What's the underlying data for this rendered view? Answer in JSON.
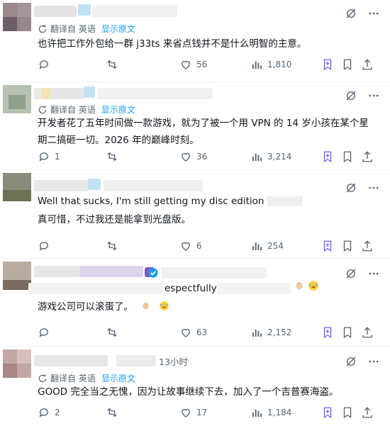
{
  "posts": [
    {
      "translate": {
        "label": "翻译自 英语",
        "show_original": "显示原文"
      },
      "text": "也许把工作外包给一群 j33ts 来省点钱并不是什么明智的主意。",
      "stats": {
        "replies": "",
        "reposts": "",
        "likes": "56",
        "views": "1,810"
      }
    },
    {
      "translate": {
        "label": "翻译自 英语",
        "show_original": "显示原文"
      },
      "text_line1": "开发者花了五年时间做一款游戏，就为了被一个用 VPN 的 14 岁小孩在某个星",
      "text_line2": "期二搞砸一切。2026 年的巅峰时刻。",
      "stats": {
        "replies": "1",
        "reposts": "",
        "likes": "36",
        "views": "3,214"
      }
    },
    {
      "original_text": "Well that sucks, I'm still getting my disc edition",
      "text": "真可惜，不过我还是能拿到光盘版。",
      "stats": {
        "replies": "",
        "reposts": "",
        "likes": "6",
        "views": "254"
      }
    },
    {
      "original_text_fragment": "espectfully",
      "text": "游戏公司可以滚蛋了。",
      "stats": {
        "replies": "",
        "reposts": "",
        "likes": "63",
        "views": "2,152"
      }
    },
    {
      "timestamp": "13小时",
      "translate": {
        "label": "翻译自 英语",
        "show_original": "显示原文"
      },
      "text": "GOOD 完全当之无愧，因为让故事继续下去，加入了一个吉普赛海盗。",
      "stats": {
        "replies": "2",
        "reposts": "",
        "likes": "17",
        "views": "1,184"
      }
    }
  ],
  "icons": [
    "translate-icon",
    "reply-icon",
    "repost-icon",
    "like-icon",
    "views-icon",
    "grok-icon",
    "bookmark-icon",
    "share-icon",
    "hide-icon",
    "more-icon",
    "verified-icon"
  ],
  "colors": {
    "muted": "#536471",
    "link": "#1d9bf0",
    "grok": "#7856ff",
    "text": "#0f1419"
  }
}
